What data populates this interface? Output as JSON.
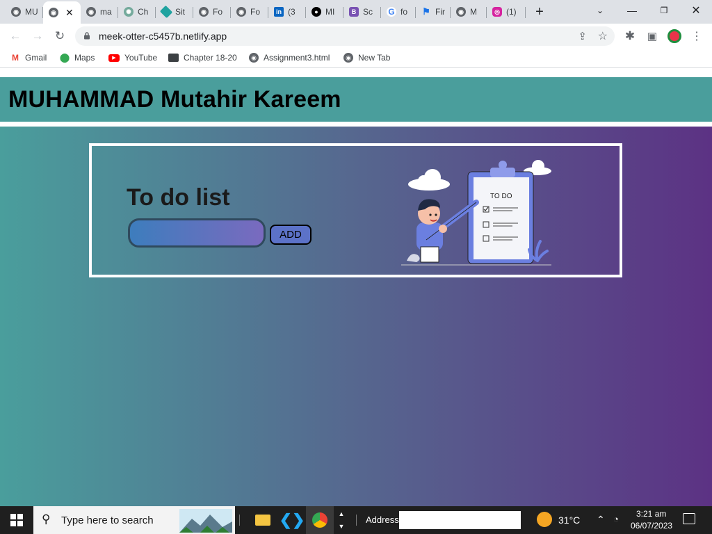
{
  "browser": {
    "tabs": [
      {
        "label": "MU",
        "icon": "globe-icon"
      },
      {
        "label": "",
        "icon": "globe-icon",
        "active": true
      },
      {
        "label": "ma",
        "icon": "globe-icon"
      },
      {
        "label": "Ch",
        "icon": "chatgpt-icon"
      },
      {
        "label": "Sit",
        "icon": "netlify-icon"
      },
      {
        "label": "Fo",
        "icon": "globe-icon"
      },
      {
        "label": "Fo",
        "icon": "globe-icon"
      },
      {
        "label": "(3",
        "icon": "linkedin-icon"
      },
      {
        "label": "MI",
        "icon": "github-icon"
      },
      {
        "label": "Sc",
        "icon": "bootstrap-icon"
      },
      {
        "label": "fo",
        "icon": "google-icon"
      },
      {
        "label": "Fir",
        "icon": "flag-icon"
      },
      {
        "label": "M",
        "icon": "globe-icon"
      },
      {
        "label": "(1)",
        "icon": "instagram-icon"
      }
    ],
    "url": "meek-otter-c5457b.netlify.app",
    "bookmarks": [
      {
        "label": "Gmail",
        "icon": "gmail-icon"
      },
      {
        "label": "Maps",
        "icon": "maps-icon"
      },
      {
        "label": "YouTube",
        "icon": "youtube-icon"
      },
      {
        "label": "Chapter 18-20",
        "icon": "folder-icon"
      },
      {
        "label": "Assignment3.html",
        "icon": "globe-icon"
      },
      {
        "label": "New Tab",
        "icon": "globe-icon"
      }
    ]
  },
  "page": {
    "header_title": "MUHAMMAD Mutahir Kareem",
    "todo_title": "To do list",
    "todo_input_value": "",
    "add_button_label": "ADD",
    "clipboard_label": "TO DO",
    "colors": {
      "header_bg": "#4a9e9c",
      "gradient_start": "#4a9e9c",
      "gradient_end": "#5c3284",
      "add_button_bg": "#5c72c8"
    }
  },
  "taskbar": {
    "search_placeholder": "Type here to search",
    "address_label": "Address",
    "temperature": "31°C",
    "time": "3:21 am",
    "date": "06/07/2023"
  }
}
